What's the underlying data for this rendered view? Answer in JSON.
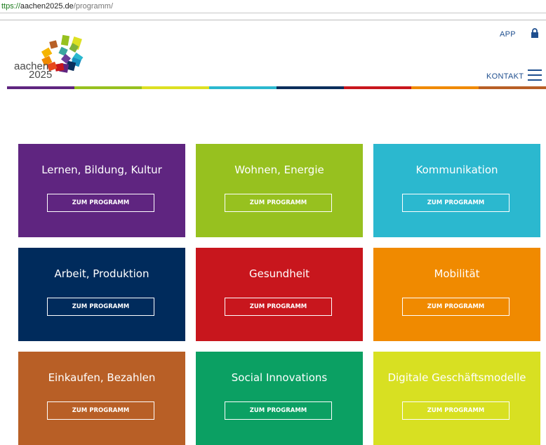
{
  "browser": {
    "url_scheme": "ttps://",
    "url_host": "aachen2025.de",
    "url_path": "/programm/"
  },
  "header": {
    "logo_word": "aachen",
    "logo_year": "2025",
    "app_label": "APP",
    "kontakt_label": "KONTAKT",
    "lock_icon": "lock-icon",
    "menu_icon": "hamburger-menu-icon",
    "strip_colors": [
      "#5f2580",
      "#97c11f",
      "#dde022",
      "#2bb8cf",
      "#0b2f5c",
      "#c8161d",
      "#f08a00",
      "#b85f26"
    ]
  },
  "tiles": [
    {
      "title": "Lernen, Bildung, Kultur",
      "button": "ZUM PROGRAMM",
      "color": "#5f2580"
    },
    {
      "title": "Wohnen, Energie",
      "button": "ZUM PROGRAMM",
      "color": "#97c11f"
    },
    {
      "title": "Kommunikation",
      "button": "ZUM PROGRAMM",
      "color": "#2bb8cf"
    },
    {
      "title": "Arbeit, Produktion",
      "button": "ZUM PROGRAMM",
      "color": "#002b5c"
    },
    {
      "title": "Gesundheit",
      "button": "ZUM PROGRAMM",
      "color": "#c8161d"
    },
    {
      "title": "Mobilität",
      "button": "ZUM PROGRAMM",
      "color": "#f08a00"
    },
    {
      "title": "Einkaufen, Bezahlen",
      "button": "ZUM PROGRAMM",
      "color": "#b85f26"
    },
    {
      "title": "Social Innovations",
      "button": "ZUM PROGRAMM",
      "color": "#0ba063"
    },
    {
      "title": "Digitale Geschäftsmodelle",
      "button": "ZUM PROGRAMM",
      "color": "#d8e022"
    }
  ]
}
